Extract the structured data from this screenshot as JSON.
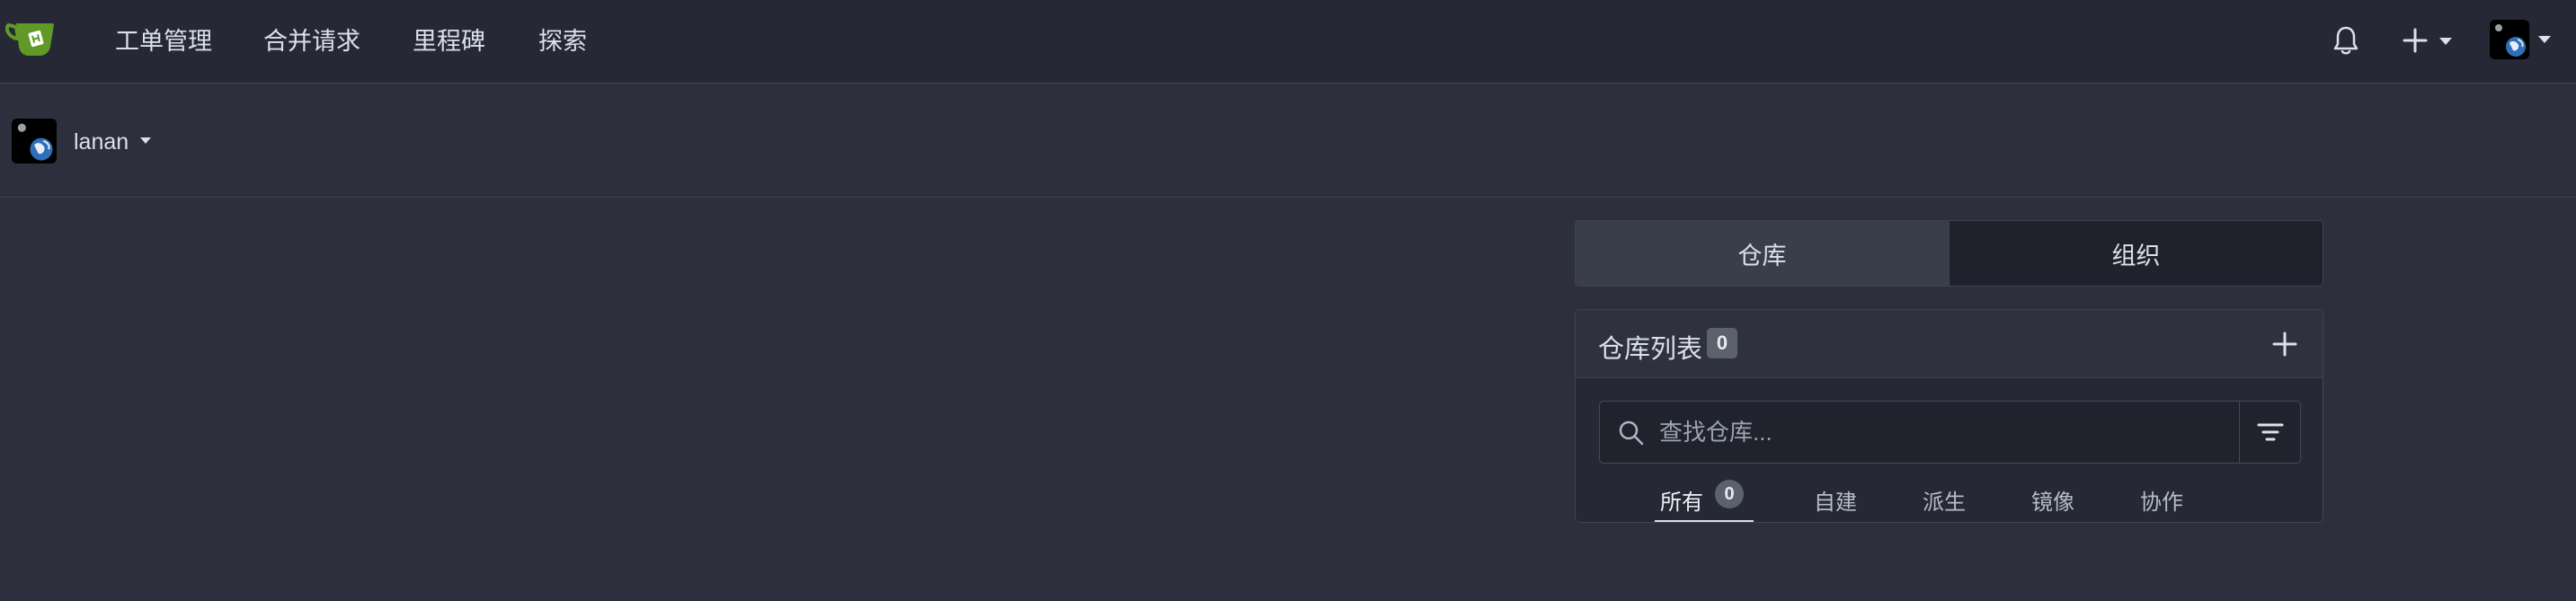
{
  "colors": {
    "page_bg": "#2d303c",
    "navbar_bg": "#262935",
    "logo_green": "#609926",
    "badge_bg": "#5c616e"
  },
  "navbar": {
    "logo_icon": "gitea-tea-cup-icon",
    "items": [
      {
        "label": "工单管理"
      },
      {
        "label": "合并请求"
      },
      {
        "label": "里程碑"
      },
      {
        "label": "探索"
      }
    ],
    "notifications_icon": "bell-icon",
    "create_icon": "plus-icon",
    "avatar_icon": "earth-avatar-icon"
  },
  "context": {
    "username": "lanan",
    "avatar_icon": "earth-avatar-icon"
  },
  "tabs": [
    {
      "label": "仓库",
      "active": true
    },
    {
      "label": "组织",
      "active": false
    }
  ],
  "repo_list": {
    "title": "仓库列表",
    "count": "0",
    "add_icon": "plus-icon",
    "search": {
      "placeholder": "查找仓库...",
      "value": ""
    },
    "filter_icon": "filter-icon",
    "filters": [
      {
        "label": "所有",
        "count": "0",
        "active": true
      },
      {
        "label": "自建"
      },
      {
        "label": "派生"
      },
      {
        "label": "镜像"
      },
      {
        "label": "协作"
      }
    ]
  }
}
